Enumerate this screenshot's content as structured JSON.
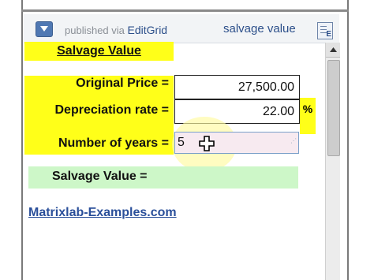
{
  "header": {
    "published_via": "published via",
    "brand": "EditGrid",
    "doc_title": "salvage value",
    "sheet_icon_letter": "E"
  },
  "sheet": {
    "title": "Salvage Value",
    "rows": {
      "original_price": {
        "label": "Original Price =",
        "value": "27,500.00"
      },
      "depreciation_rate": {
        "label": "Depreciation rate =",
        "value": "22.00",
        "unit": "%"
      },
      "number_of_years": {
        "label": "Number of years =",
        "value": "5"
      },
      "salvage_value": {
        "label": "Salvage Value ="
      }
    },
    "link_text": "Matrixlab-Examples.com"
  },
  "colors": {
    "yellow": "#ffff19",
    "green": "#cdf7c8",
    "link": "#2a4f9a",
    "brand": "#2c4f8a"
  },
  "icons": {
    "menu": "dropdown-menu-icon",
    "sheet": "spreadsheet-icon",
    "cursor": "crosshair-cursor-icon",
    "scroll_up": "scroll-up-arrow-icon"
  }
}
